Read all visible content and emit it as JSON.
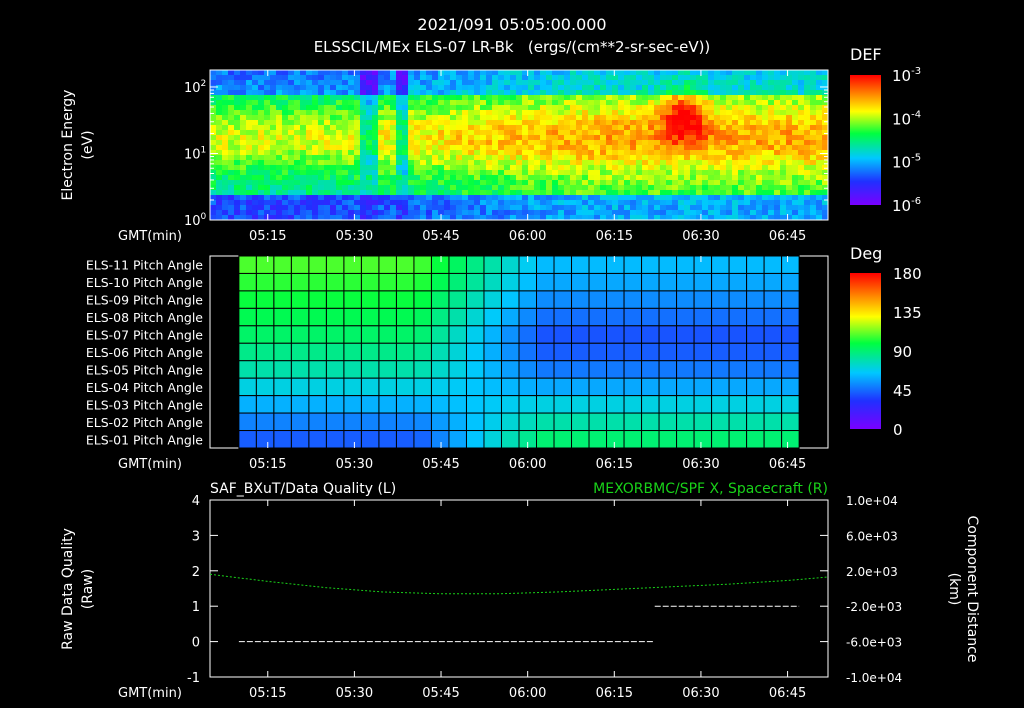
{
  "header": {
    "title": "2021/091 05:05:00.000",
    "subtitle": "ELSSCIL/MEx ELS-07 LR-Bk   (ergs/(cm**2-sr-sec-eV))"
  },
  "time_axis": {
    "label": "GMT(min)",
    "ticks": [
      "05:15",
      "05:30",
      "05:45",
      "06:00",
      "06:15",
      "06:30",
      "06:45"
    ]
  },
  "colors": {
    "background": "#000000",
    "foreground": "#ffffff",
    "green_trace": "#19d219"
  },
  "chart_data": [
    {
      "type": "heatmap",
      "name": "electron-spectrogram",
      "ylabel": "Electron Energy (eV)",
      "ylabel_lines": [
        "Electron Energy",
        "(eV)"
      ],
      "yscale": "log",
      "ytick_labels": [
        {
          "base": "10",
          "exp": "2"
        },
        {
          "base": "10",
          "exp": "1"
        },
        {
          "base": "10",
          "exp": "0"
        }
      ],
      "ylim": [
        1,
        180
      ],
      "xlabel": "GMT(min)",
      "colorbar": {
        "title": "DEF",
        "scale": "log",
        "ticks": [
          {
            "base": "10",
            "exp": "-3"
          },
          {
            "base": "10",
            "exp": "-4"
          },
          {
            "base": "10",
            "exp": "-5"
          },
          {
            "base": "10",
            "exp": "-6"
          }
        ],
        "range": [
          1e-06,
          0.001
        ]
      }
    },
    {
      "type": "heatmap",
      "name": "pitch-angle-panel",
      "rows": [
        "ELS-11 Pitch Angle",
        "ELS-10 Pitch Angle",
        "ELS-09 Pitch Angle",
        "ELS-08 Pitch Angle",
        "ELS-07 Pitch Angle",
        "ELS-06 Pitch Angle",
        "ELS-05 Pitch Angle",
        "ELS-04 Pitch Angle",
        "ELS-03 Pitch Angle",
        "ELS-02 Pitch Angle",
        "ELS-01 Pitch Angle"
      ],
      "early_values": [
        108,
        104,
        100,
        96,
        92,
        86,
        80,
        70,
        60,
        50,
        42
      ],
      "late_values": [
        62,
        58,
        52,
        46,
        40,
        42,
        48,
        58,
        70,
        80,
        90
      ],
      "xlabel": "GMT(min)",
      "colorbar": {
        "title": "Deg",
        "ticks": [
          "180",
          "135",
          "90",
          "45",
          "0"
        ],
        "range": [
          0,
          180
        ]
      }
    },
    {
      "type": "line",
      "name": "data-quality-and-position",
      "left_title": "SAF_BXuT/Data Quality (L)",
      "right_title": "MEXORBMC/SPF X, Spacecraft (R)",
      "ylabel_left_lines": [
        "Raw Data Quality",
        "(Raw)"
      ],
      "ylabel_right_lines": [
        "Component Distance",
        "(km)"
      ],
      "ylim_left": [
        -1,
        4
      ],
      "yticks_left": [
        "4",
        "3",
        "2",
        "1",
        "0",
        "-1"
      ],
      "ylim_right": [
        -10000,
        10000
      ],
      "yticks_right": [
        "1.0e+04",
        "6.0e+03",
        "2.0e+03",
        "-2.0e+03",
        "-6.0e+03",
        "-1.0e+04"
      ],
      "xlabel": "GMT(min)",
      "series": [
        {
          "axis": "left",
          "segments": [
            {
              "x": [
                "05:10",
                "06:22"
              ],
              "y": [
                0,
                0
              ]
            },
            {
              "x": [
                "06:22",
                "06:47"
              ],
              "y": [
                1,
                1
              ]
            }
          ]
        },
        {
          "axis": "right",
          "x": [
            "05:05",
            "05:15",
            "05:25",
            "05:35",
            "05:45",
            "05:55",
            "06:05",
            "06:15",
            "06:25",
            "06:35",
            "06:45",
            "06:52"
          ],
          "y": [
            1600,
            800,
            100,
            -400,
            -600,
            -600,
            -400,
            -100,
            200,
            500,
            900,
            1300
          ]
        }
      ]
    }
  ]
}
